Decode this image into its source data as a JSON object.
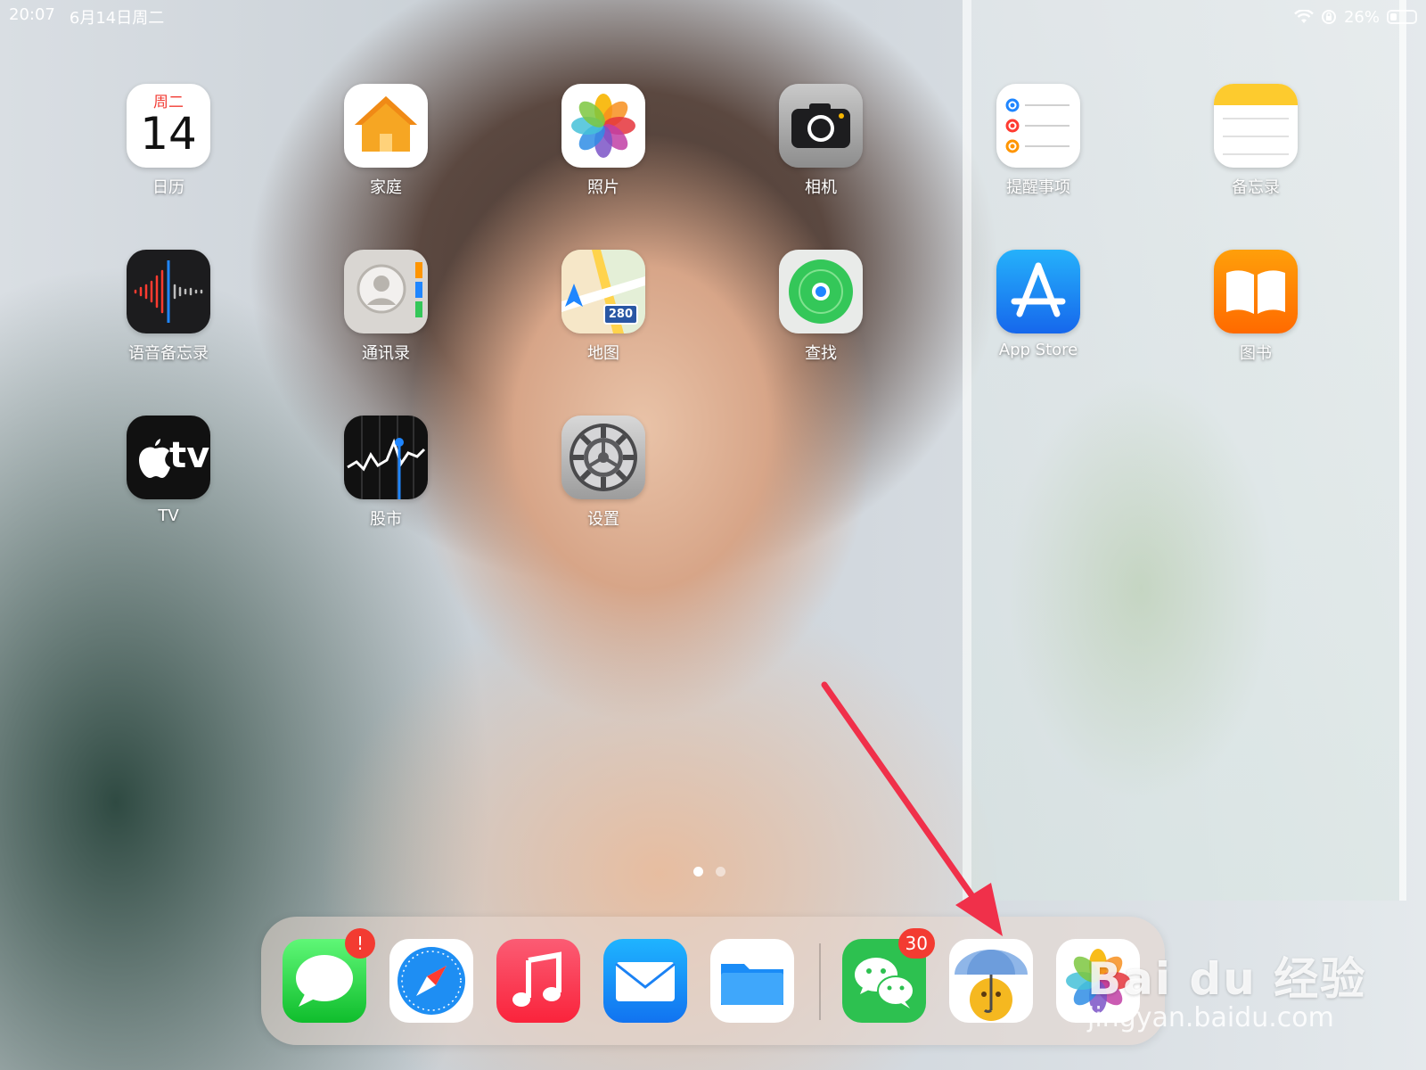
{
  "status_bar": {
    "time": "20:07",
    "date": "6月14日周二",
    "battery": "26%",
    "battery_level": 0.26
  },
  "home_apps": [
    {
      "label": "日历",
      "icon": "calendar-icon",
      "weekday": "周二",
      "day": "14"
    },
    {
      "label": "家庭",
      "icon": "home-icon"
    },
    {
      "label": "照片",
      "icon": "photos-icon"
    },
    {
      "label": "相机",
      "icon": "camera-icon"
    },
    {
      "label": "提醒事项",
      "icon": "reminders-icon"
    },
    {
      "label": "备忘录",
      "icon": "notes-icon"
    },
    {
      "label": "语音备忘录",
      "icon": "voice-memos-icon"
    },
    {
      "label": "通讯录",
      "icon": "contacts-icon"
    },
    {
      "label": "地图",
      "icon": "maps-icon",
      "route": "280"
    },
    {
      "label": "查找",
      "icon": "find-my-icon"
    },
    {
      "label": "App Store",
      "icon": "app-store-icon"
    },
    {
      "label": "图书",
      "icon": "books-icon"
    },
    {
      "label": "TV",
      "icon": "apple-tv-icon",
      "text": "tv"
    },
    {
      "label": "股市",
      "icon": "stocks-icon"
    },
    {
      "label": "设置",
      "icon": "settings-icon"
    }
  ],
  "page_indicator": {
    "pages": 2,
    "current": 1
  },
  "dock": {
    "apps": [
      {
        "name": "messages",
        "icon": "messages-icon",
        "badge": "!"
      },
      {
        "name": "safari",
        "icon": "safari-icon"
      },
      {
        "name": "music",
        "icon": "music-icon"
      },
      {
        "name": "mail",
        "icon": "mail-icon"
      },
      {
        "name": "files",
        "icon": "files-icon"
      },
      {
        "name": "wechat",
        "icon": "wechat-icon",
        "badge": "30"
      },
      {
        "name": "weather",
        "icon": "umbrella-weather-icon"
      },
      {
        "name": "photos",
        "icon": "photos-icon"
      }
    ]
  },
  "watermark": {
    "logo": "Bai du 经验",
    "url": "jingyan.baidu.com"
  },
  "colors": {
    "badge": "#f33b31",
    "arrow": "#f0304a"
  }
}
